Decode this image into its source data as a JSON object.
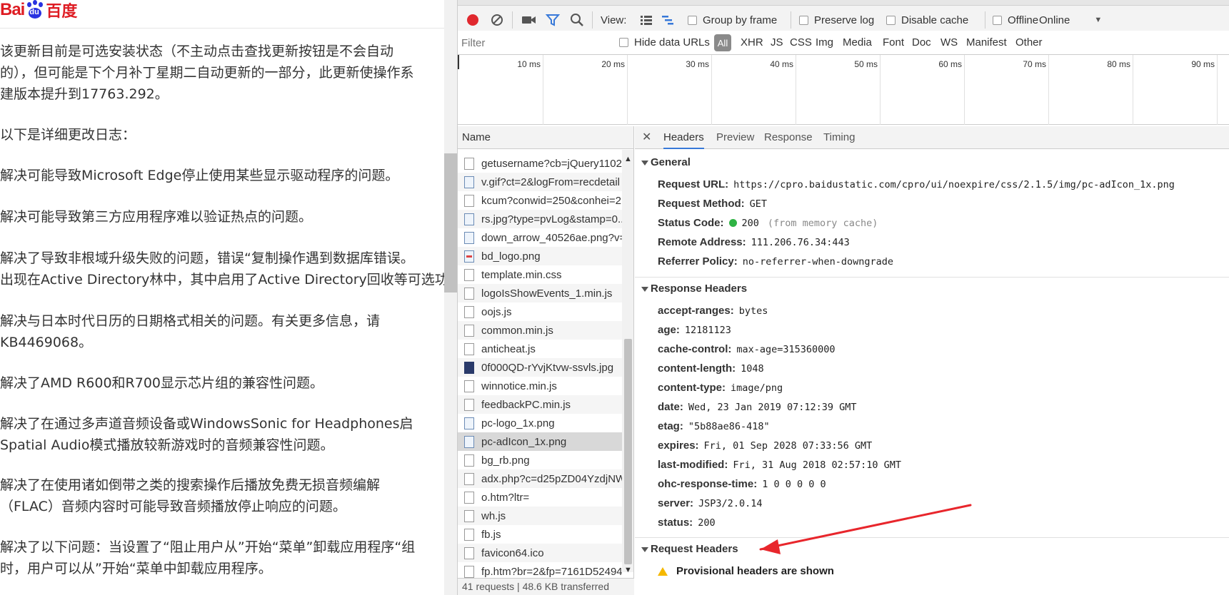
{
  "article": {
    "logo": {
      "text_latin": "Bai",
      "text_du": "du",
      "text_cn": "百度"
    },
    "paragraphs": [
      "该更新目前是可选安装状态（不主动点击查找更新按钮是不会自动",
      "的），但可能是下个月补丁星期二自动更新的一部分，此更新使操作系",
      "建版本提升到17763.292。",
      "以下是详细更改日志：",
      "解决可能导致Microsoft Edge停止使用某些显示驱动程序的问题。",
      "解决可能导致第三方应用程序难以验证热点的问题。",
      "解决了导致非根域升级失败的问题，错误“复制操作遇到数据库错误。",
      "出现在Active Directory林中，其中启用了Active Directory回收等可选功",
      "解决与日本时代日历的日期格式相关的问题。有关更多信息，请",
      "KB4469068。",
      "解决了AMD R600和R700显示芯片组的兼容性问题。",
      "解决了在通过多声道音频设备或WindowsSonic for Headphones启",
      "Spatial Audio模式播放较新游戏时的音频兼容性问题。",
      "解决了在使用诸如倒带之类的搜索操作后播放免费无损音频编解",
      "（FLAC）音频内容时可能导致音频播放停止响应的问题。",
      "解决了以下问题：当设置了“阻止用户从”开始“菜单”卸载应用程序“组",
      "时，用户可以从”开始“菜单中卸载应用程序。"
    ]
  },
  "toolbar": {
    "view_label": "View:",
    "group_by_frame": "Group by frame",
    "preserve_log": "Preserve log",
    "disable_cache": "Disable cache",
    "offline": "Offline",
    "throttle": "Online"
  },
  "filterbar": {
    "placeholder": "Filter",
    "hide_data_urls": "Hide data URLs",
    "types": [
      "All",
      "XHR",
      "JS",
      "CSS",
      "Img",
      "Media",
      "Font",
      "Doc",
      "WS",
      "Manifest",
      "Other"
    ]
  },
  "overview": {
    "ticks": [
      "10 ms",
      "20 ms",
      "30 ms",
      "40 ms",
      "50 ms",
      "60 ms",
      "70 ms",
      "80 ms",
      "90 ms"
    ]
  },
  "requests": {
    "header": "Name",
    "items": [
      {
        "name": "getusername?cb=jQuery1102...",
        "icon": "doc"
      },
      {
        "name": "v.gif?ct=2&logFrom=recdetail",
        "icon": "img"
      },
      {
        "name": "kcum?conwid=250&conhei=2",
        "icon": "doc"
      },
      {
        "name": "rs.jpg?type=pvLog&stamp=0..",
        "icon": "img"
      },
      {
        "name": "down_arrow_40526ae.png?v=..",
        "icon": "img"
      },
      {
        "name": "bd_logo.png",
        "icon": "img-red"
      },
      {
        "name": "template.min.css",
        "icon": "doc"
      },
      {
        "name": "logoIsShowEvents_1.min.js",
        "icon": "doc"
      },
      {
        "name": "oojs.js",
        "icon": "doc"
      },
      {
        "name": "common.min.js",
        "icon": "doc"
      },
      {
        "name": "anticheat.js",
        "icon": "doc"
      },
      {
        "name": "0f000QD-rYvjKtvw-ssvls.jpg",
        "icon": "img-dark"
      },
      {
        "name": "winnotice.min.js",
        "icon": "doc"
      },
      {
        "name": "feedbackPC.min.js",
        "icon": "doc"
      },
      {
        "name": "pc-logo_1x.png",
        "icon": "img"
      },
      {
        "name": "pc-adIcon_1x.png",
        "icon": "img"
      },
      {
        "name": "bg_rb.png",
        "icon": "doc"
      },
      {
        "name": "adx.php?c=d25pZD04YzdjNW",
        "icon": "doc"
      },
      {
        "name": "o.htm?ltr=",
        "icon": "doc"
      },
      {
        "name": "wh.js",
        "icon": "doc"
      },
      {
        "name": "fb.js",
        "icon": "doc"
      },
      {
        "name": "favicon64.ico",
        "icon": "doc"
      },
      {
        "name": "fp.htm?br=2&fp=7161D52494",
        "icon": "doc"
      }
    ],
    "status": "41 requests | 48.6 KB transferred"
  },
  "details": {
    "tabs": [
      "Headers",
      "Preview",
      "Response",
      "Timing"
    ],
    "active_tab": "Headers",
    "general": {
      "title": "General",
      "rows": [
        {
          "k": "Request URL:",
          "v": "https://cpro.baidustatic.com/cpro/ui/noexpire/css/2.1.5/img/pc-adIcon_1x.png"
        },
        {
          "k": "Request Method:",
          "v": "GET"
        },
        {
          "k": "Status Code:",
          "v": "200",
          "extra": "(from memory cache)"
        },
        {
          "k": "Remote Address:",
          "v": "111.206.76.34:443"
        },
        {
          "k": "Referrer Policy:",
          "v": "no-referrer-when-downgrade"
        }
      ]
    },
    "response_headers": {
      "title": "Response Headers",
      "rows": [
        {
          "k": "accept-ranges:",
          "v": "bytes"
        },
        {
          "k": "age:",
          "v": "12181123"
        },
        {
          "k": "cache-control:",
          "v": "max-age=315360000"
        },
        {
          "k": "content-length:",
          "v": "1048"
        },
        {
          "k": "content-type:",
          "v": "image/png"
        },
        {
          "k": "date:",
          "v": "Wed, 23 Jan 2019 07:12:39 GMT"
        },
        {
          "k": "etag:",
          "v": "\"5b88ae86-418\""
        },
        {
          "k": "expires:",
          "v": "Fri, 01 Sep 2028 07:33:56 GMT"
        },
        {
          "k": "last-modified:",
          "v": "Fri, 31 Aug 2018 02:57:10 GMT"
        },
        {
          "k": "ohc-response-time:",
          "v": "1 0 0 0 0 0"
        },
        {
          "k": "server:",
          "v": "JSP3/2.0.14"
        },
        {
          "k": "status:",
          "v": "200"
        }
      ]
    },
    "request_headers": {
      "title": "Request Headers",
      "warning": "Provisional headers are shown"
    }
  },
  "colors": {
    "record_red": "#e0282e",
    "filter_blue": "#3879d9",
    "status_green": "#2fb344",
    "arrow_red": "#e8262c",
    "warning_yellow": "#f5b800"
  }
}
